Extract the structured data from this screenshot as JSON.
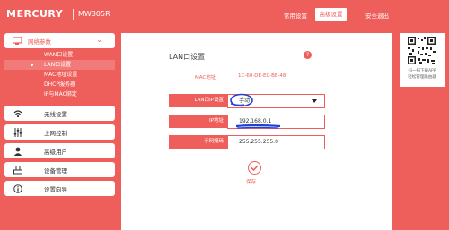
{
  "header": {
    "logo": "MERCURY",
    "model": "MW305R",
    "nav": [
      {
        "label": "常用设置",
        "active": false
      },
      {
        "label": "高级设置",
        "active": true
      },
      {
        "label": "安全退出",
        "active": false
      }
    ]
  },
  "sidebar": {
    "network": {
      "label": "网络参数",
      "icon": "network-icon",
      "submenu": [
        {
          "label": "WAN口设置",
          "active": false
        },
        {
          "label": "LAN口设置",
          "active": true
        },
        {
          "label": "MAC地址设置",
          "active": false
        },
        {
          "label": "DHCP服务器",
          "active": false
        },
        {
          "label": "IP与MAC绑定",
          "active": false
        }
      ]
    },
    "items": [
      {
        "label": "无线设置",
        "icon": "wifi-icon"
      },
      {
        "label": "上网控制",
        "icon": "sliders-icon"
      },
      {
        "label": "高级用户",
        "icon": "user-icon"
      },
      {
        "label": "设备管理",
        "icon": "device-icon"
      },
      {
        "label": "设置向导",
        "icon": "info-icon"
      }
    ]
  },
  "main": {
    "title": "LAN口设置",
    "mac": {
      "label": "MAC地址",
      "value": "1C-60-DE-EC-BE-48"
    },
    "lan_ip_setting": {
      "label": "LAN口IP设置",
      "value": "手动"
    },
    "ip_address": {
      "label": "IP地址",
      "value": "192.168.0.1"
    },
    "subnet_mask": {
      "label": "子网掩码",
      "value": "255.255.255.0"
    },
    "save_label": "保存"
  },
  "qr_panel": {
    "line1": "扫一扫下载APP",
    "line2": "轻松管理路由器"
  },
  "colors": {
    "accent": "#ee5f5b",
    "panel": "#ffffff",
    "annotation": "#1f3fd6"
  }
}
